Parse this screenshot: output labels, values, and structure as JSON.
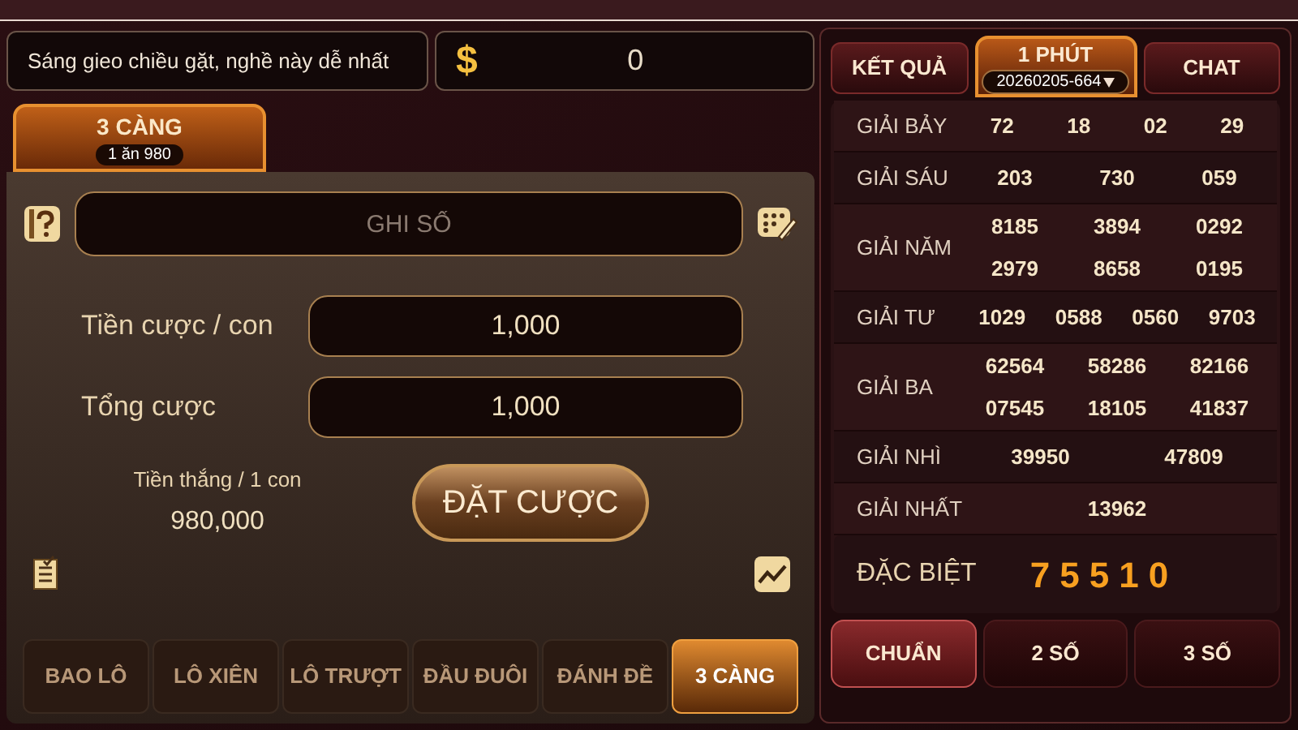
{
  "slogan": "Sáng gieo chiều gặt, nghề này dễ nhất",
  "balance": {
    "currency": "$",
    "value": "0"
  },
  "game_tab": {
    "title": "3 CÀNG",
    "odds": "1 ăn 980"
  },
  "number_field": {
    "placeholder": "GHI SỐ"
  },
  "bet_per_number": {
    "label": "Tiền cược / con",
    "value": "1,000"
  },
  "total_bet": {
    "label": "Tổng cược",
    "value": "1,000"
  },
  "win_per_number": {
    "label": "Tiền thắng / 1 con",
    "value": "980,000"
  },
  "place_bet_button": "ĐẶT CƯỢC",
  "bet_types": [
    {
      "label": "BAO LÔ",
      "selected": false
    },
    {
      "label": "LÔ XIÊN",
      "selected": false
    },
    {
      "label": "LÔ TRƯỢT",
      "selected": false
    },
    {
      "label": "ĐẦU ĐUÔI",
      "selected": false
    },
    {
      "label": "ĐÁNH ĐỀ",
      "selected": false
    },
    {
      "label": "3 CÀNG",
      "selected": true
    }
  ],
  "result_tabs": [
    {
      "label": "KẾT QUẢ",
      "selected": false
    },
    {
      "label": "1 PHÚT",
      "round": "20260205-664",
      "selected": true
    },
    {
      "label": "CHAT",
      "selected": false
    }
  ],
  "prizes": [
    {
      "label": "GIẢI BẢY",
      "rows": [
        [
          "72",
          "18",
          "02",
          "29"
        ]
      ]
    },
    {
      "label": "GIẢI SÁU",
      "rows": [
        [
          "203",
          "730",
          "059"
        ]
      ]
    },
    {
      "label": "GIẢI NĂM",
      "rows": [
        [
          "8185",
          "3894",
          "0292"
        ],
        [
          "2979",
          "8658",
          "0195"
        ]
      ]
    },
    {
      "label": "GIẢI TƯ",
      "rows": [
        [
          "1029",
          "0588",
          "0560",
          "9703"
        ]
      ]
    },
    {
      "label": "GIẢI BA",
      "rows": [
        [
          "62564",
          "58286",
          "82166"
        ],
        [
          "07545",
          "18105",
          "41837"
        ]
      ]
    },
    {
      "label": "GIẢI NHÌ",
      "rows": [
        [
          "39950",
          "47809"
        ]
      ]
    },
    {
      "label": "GIẢI NHẤT",
      "rows": [
        [
          "13962"
        ]
      ]
    }
  ],
  "special": {
    "label": "ĐẶC BIỆT",
    "value": "75510"
  },
  "view_tabs": [
    {
      "label": "CHUẨN",
      "selected": true
    },
    {
      "label": "2 SỐ",
      "selected": false
    },
    {
      "label": "3 SỐ",
      "selected": false
    }
  ]
}
